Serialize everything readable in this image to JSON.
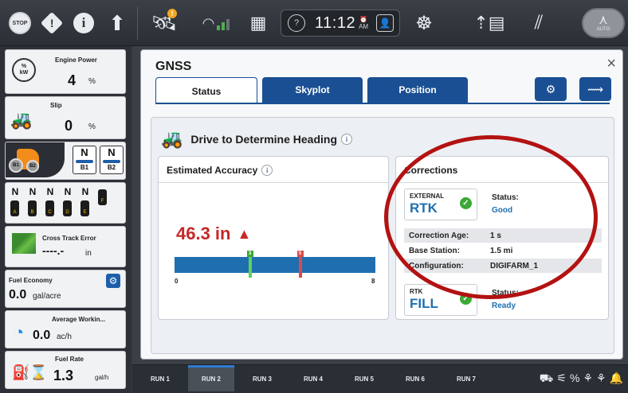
{
  "topbar": {
    "stop_label": "STOP",
    "warning_glyph": "!",
    "info_glyph": "i",
    "sat_alert": "!",
    "clock_help": "?",
    "time": "11:12",
    "am": "AM",
    "auto_label": "AUTO"
  },
  "left_panel": {
    "engine_power": {
      "label": "Engine Power",
      "value": "4",
      "unit": "%",
      "icon_text": "%\nkW"
    },
    "slip": {
      "label": "Slip",
      "value": "0",
      "unit": "%"
    },
    "implement": {
      "wheel1": "B1",
      "wheel2": "B2",
      "boxes": [
        {
          "n": "N",
          "b": "B1"
        },
        {
          "n": "N",
          "b": "B2"
        }
      ]
    },
    "gears": [
      {
        "n": "N",
        "lv": "A"
      },
      {
        "n": "N",
        "lv": "B"
      },
      {
        "n": "N",
        "lv": "C"
      },
      {
        "n": "N",
        "lv": "D"
      },
      {
        "n": "N",
        "lv": "E"
      },
      {
        "n": "",
        "lv": "F"
      }
    ],
    "cross_track": {
      "label": "Cross Track Error",
      "value": "----.-",
      "unit": "in"
    },
    "fuel_economy": {
      "label": "Fuel Economy",
      "value": "0.0",
      "unit": "gal/acre"
    },
    "avg_work_rate": {
      "label": "Average Workin...",
      "value": "0.0",
      "unit": "ac/h"
    },
    "fuel_rate": {
      "label": "Fuel Rate",
      "value": "1.3",
      "unit": "gal/h"
    }
  },
  "dialog": {
    "title": "GNSS",
    "close": "×",
    "tabs": [
      {
        "label": "Status"
      },
      {
        "label": "Skyplot"
      },
      {
        "label": "Position"
      }
    ],
    "heading": "Drive to Determine Heading",
    "info": "i",
    "accuracy": {
      "title": "Estimated Accuracy",
      "value": "46.3 in",
      "warn": "▲",
      "marker_green": "3",
      "marker_red": "5",
      "min_label": "0",
      "max_label": "8",
      "green_value": 3,
      "red_value": 5,
      "scale_max": 8
    },
    "corrections": {
      "title": "Corrections",
      "primary": {
        "top": "EXTERNAL",
        "big": "RTK",
        "status_label": "Status:",
        "status_value": "Good"
      },
      "rows": [
        {
          "k": "Correction Age:",
          "v": "1 s"
        },
        {
          "k": "Base Station:",
          "v": "1.5 mi"
        },
        {
          "k": "Configuration:",
          "v": "DIGIFARM_1"
        }
      ],
      "secondary": {
        "top": "RTK",
        "big": "FILL",
        "status_label": "Status:",
        "status_value": "Ready"
      }
    }
  },
  "bottombar": {
    "runs": [
      "RUN 1",
      "RUN 2",
      "RUN 3",
      "RUN 4",
      "RUN 5",
      "RUN 6",
      "RUN 7"
    ],
    "active_run": "RUN 2"
  },
  "colors": {
    "accent_blue": "#1a4f93",
    "alert_red": "#c62828",
    "ok_green": "#3aa935",
    "highlight_ellipse": "#b31212"
  }
}
